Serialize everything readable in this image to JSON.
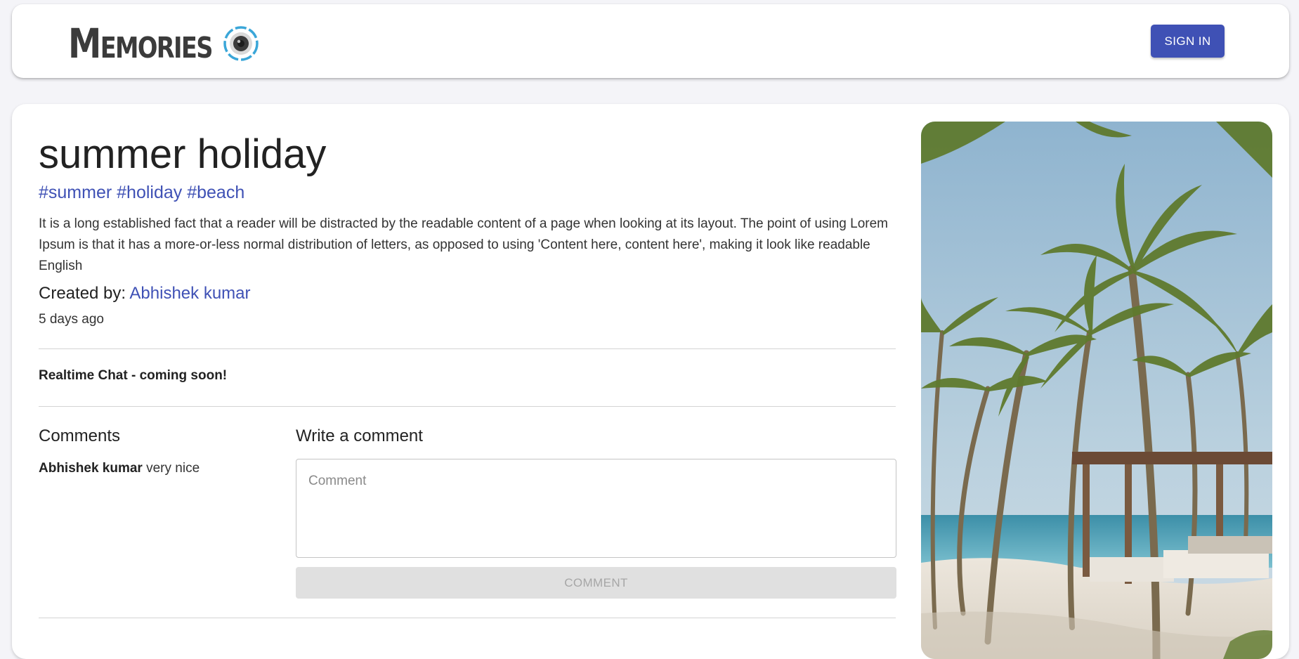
{
  "header": {
    "brand": "Memories",
    "brand_icon": "camera-lens-icon",
    "signin_label": "SIGN IN",
    "accent": "#3f51b5"
  },
  "post": {
    "title": "summer holiday",
    "tags": "#summer #holiday #beach",
    "message": "It is a long established fact that a reader will be distracted by the readable content of a page when looking at its layout. The point of using Lorem Ipsum is that it has a more-or-less normal distribution of letters, as opposed to using 'Content here, content here', making it look like readable English",
    "created_by_label": "Created by:",
    "creator": "Abhishek kumar",
    "time_ago": "5 days ago",
    "image_alt": "beach-palm-trees-image"
  },
  "chat": {
    "note": "Realtime Chat - coming soon!"
  },
  "comments": {
    "heading": "Comments",
    "items": [
      {
        "author": "Abhishek kumar",
        "text": "very nice"
      }
    ],
    "write_heading": "Write a comment",
    "input_placeholder": "Comment",
    "input_value": "",
    "submit_label": "COMMENT"
  }
}
